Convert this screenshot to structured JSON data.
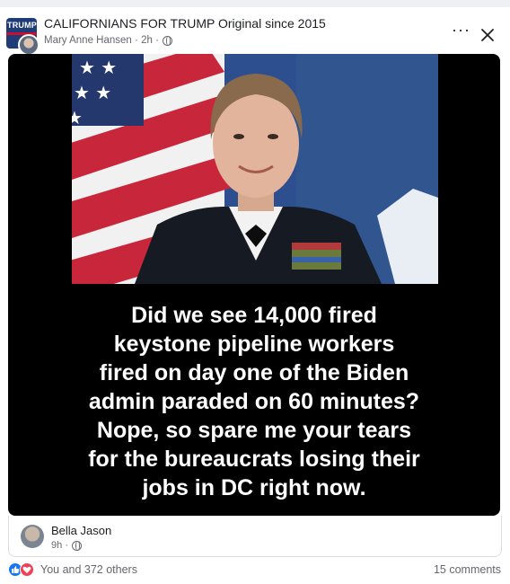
{
  "header": {
    "group_name": "CALIFORNIANS FOR TRUMP Original since 2015",
    "group_logo_text": "TRUMP",
    "author": "Mary Anne Hansen",
    "separator": "·",
    "time": "2h",
    "privacy_icon": "globe-icon",
    "more_icon": "more-options-icon",
    "close_icon": "close-icon"
  },
  "post": {
    "caption_lines": [
      "Did we see 14,000 fired",
      "keystone pipeline workers",
      "fired on day one of the Biden",
      "admin paraded on 60 minutes?",
      "Nope, so spare me your tears",
      "for the bureaucrats losing their",
      "jobs in DC right now."
    ]
  },
  "comment": {
    "name": "Bella Jason",
    "time": "9h",
    "separator": "·",
    "privacy_icon": "globe-icon"
  },
  "footer": {
    "reactions_text": "You and 372 others",
    "comments_text": "15 comments",
    "colors": {
      "like": "#1877f2",
      "love": "#f33e58"
    }
  }
}
